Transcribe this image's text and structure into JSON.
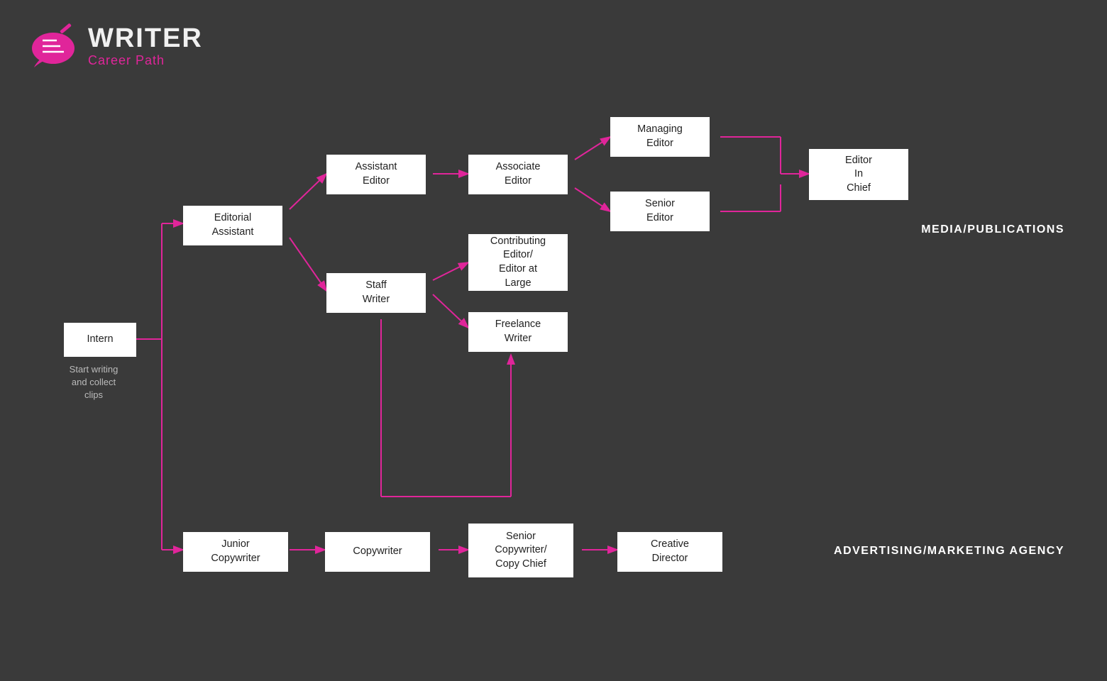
{
  "logo": {
    "title": "WRITER",
    "subtitle": "Career Path"
  },
  "nodes": {
    "intern": {
      "label": "Intern"
    },
    "start_writing": {
      "label": "Start writing\nand collect\nclips"
    },
    "editorial_assistant": {
      "label": "Editorial\nAssistant"
    },
    "assistant_editor": {
      "label": "Assistant\nEditor"
    },
    "staff_writer": {
      "label": "Staff\nWriter"
    },
    "associate_editor": {
      "label": "Associate\nEditor"
    },
    "contributing_editor": {
      "label": "Contributing\nEditor/\nEditor at\nLarge"
    },
    "freelance_writer": {
      "label": "Freelance\nWriter"
    },
    "managing_editor": {
      "label": "Managing\nEditor"
    },
    "senior_editor": {
      "label": "Senior\nEditor"
    },
    "editor_in_chief": {
      "label": "Editor\nIn\nChief"
    },
    "junior_copywriter": {
      "label": "Junior\nCopywriter"
    },
    "copywriter": {
      "label": "Copywriter"
    },
    "senior_copywriter": {
      "label": "Senior\nCopywriter/\nCopy Chief"
    },
    "creative_director": {
      "label": "Creative\nDirector"
    }
  },
  "section_labels": {
    "media": "MEDIA/PUBLICATIONS",
    "advertising": "ADVERTISING/MARKETING AGENCY"
  }
}
